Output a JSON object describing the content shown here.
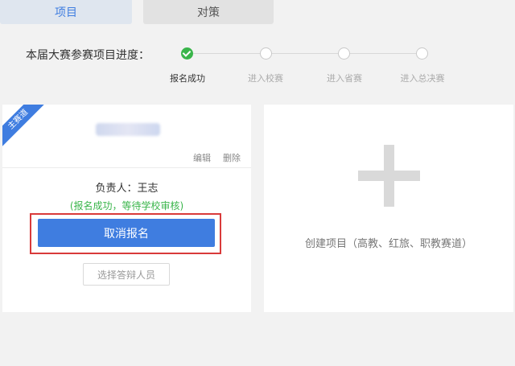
{
  "tabs": [
    {
      "label": "项目",
      "active": true
    },
    {
      "label": "对策",
      "active": false
    }
  ],
  "progress": {
    "label": "本届大赛参赛项目进度：",
    "steps": [
      {
        "label": "报名成功",
        "done": true
      },
      {
        "label": "进入校赛",
        "done": false
      },
      {
        "label": "进入省赛",
        "done": false
      },
      {
        "label": "进入总决赛",
        "done": false
      }
    ]
  },
  "project_card": {
    "ribbon": "主赛道",
    "edit_label": "编辑",
    "delete_label": "删除",
    "owner": "负责人：王志",
    "status": "(报名成功，等待学校审核)",
    "cancel_label": "取消报名",
    "select_label": "选择答辩人员"
  },
  "create_card": {
    "label": "创建项目（高教、红旅、职教赛道）"
  },
  "colors": {
    "accent": "#3f7de0",
    "success": "#39b54a",
    "highlight": "#d93a3a"
  }
}
